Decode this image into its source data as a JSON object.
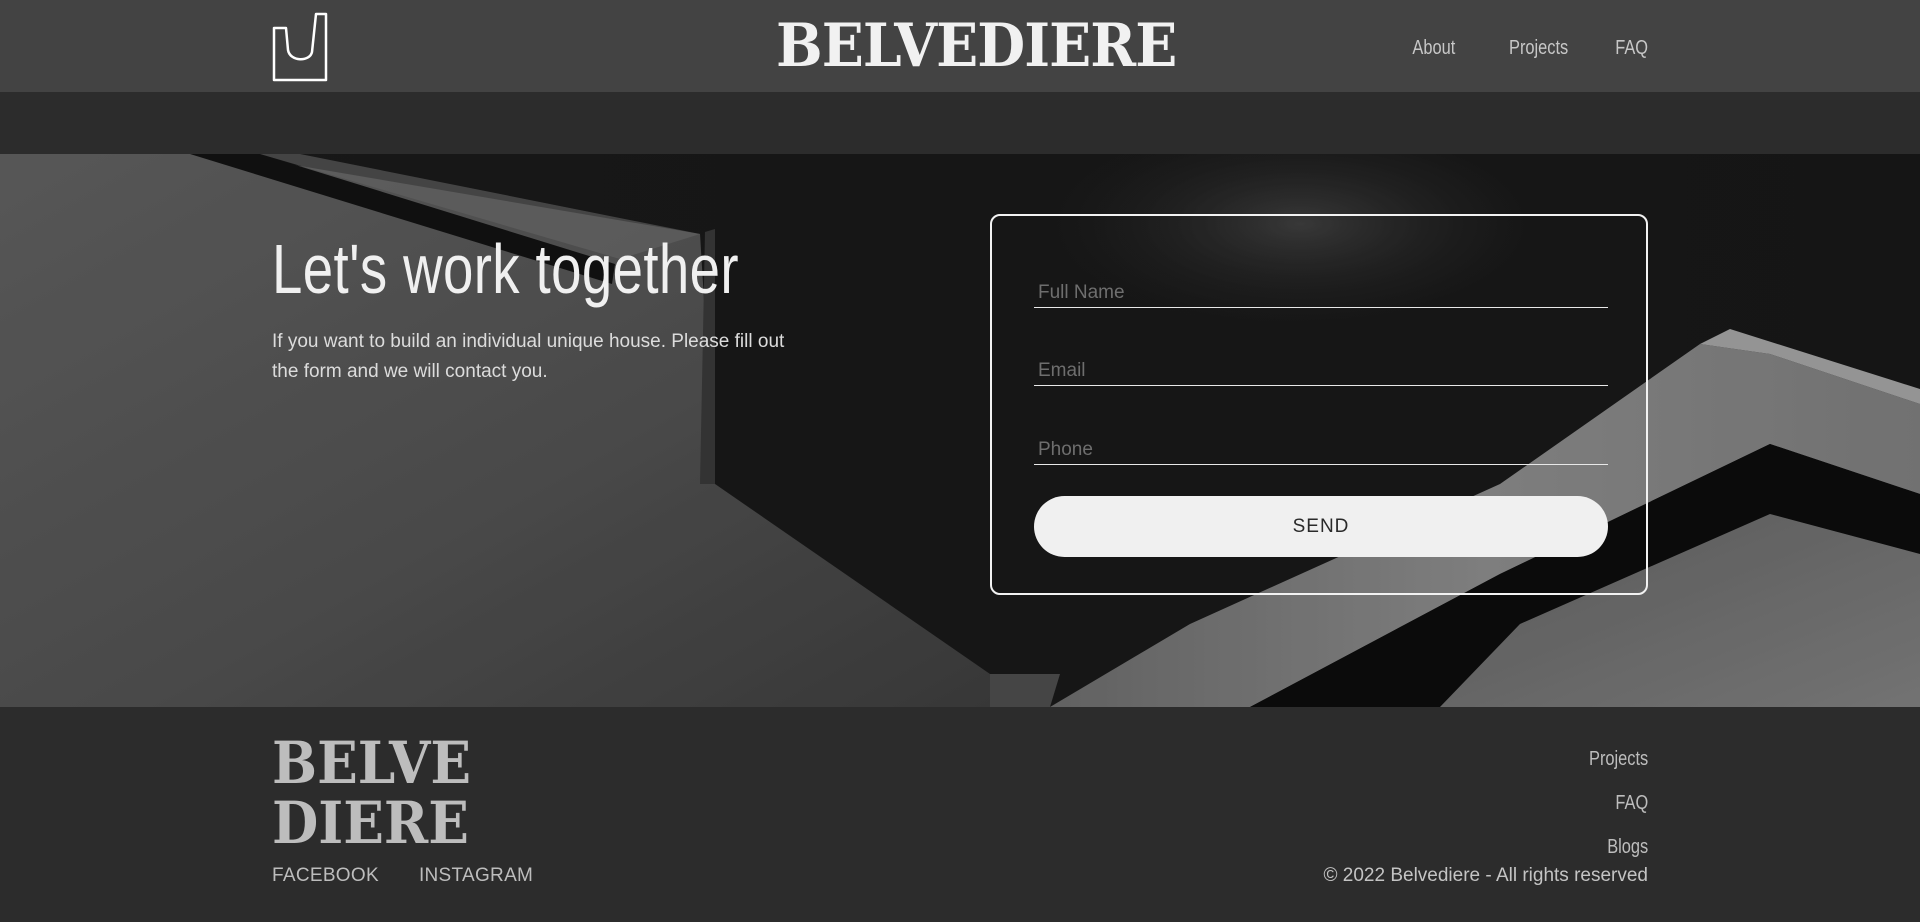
{
  "header": {
    "brand": "BELVEDIERE",
    "logo_icon": "v-shape-logo-icon",
    "nav": [
      "About",
      "Projects",
      "FAQ"
    ]
  },
  "hero": {
    "title": "Let's work together",
    "description": "If you want to build an individual unique house. Please fill out the form and we will contact you.",
    "background": "grayscale-architecture-photo"
  },
  "form": {
    "full_name_placeholder": "Full Name",
    "email_placeholder": "Email",
    "phone_placeholder": "Phone",
    "full_name_value": "",
    "email_value": "",
    "phone_value": "",
    "send_label": "SEND"
  },
  "footer": {
    "brand_line1": "BELVE",
    "brand_line2": "DIERE",
    "social": [
      "FACEBOOK",
      "INSTAGRAM"
    ],
    "links": [
      "Projects",
      "FAQ",
      "Blogs"
    ],
    "copyright": "© 2022 Belvediere - All rights reserved"
  },
  "colors": {
    "header_bg": "#434343",
    "page_bg": "#2c2c2c",
    "accent_light": "#f0f0f0"
  }
}
